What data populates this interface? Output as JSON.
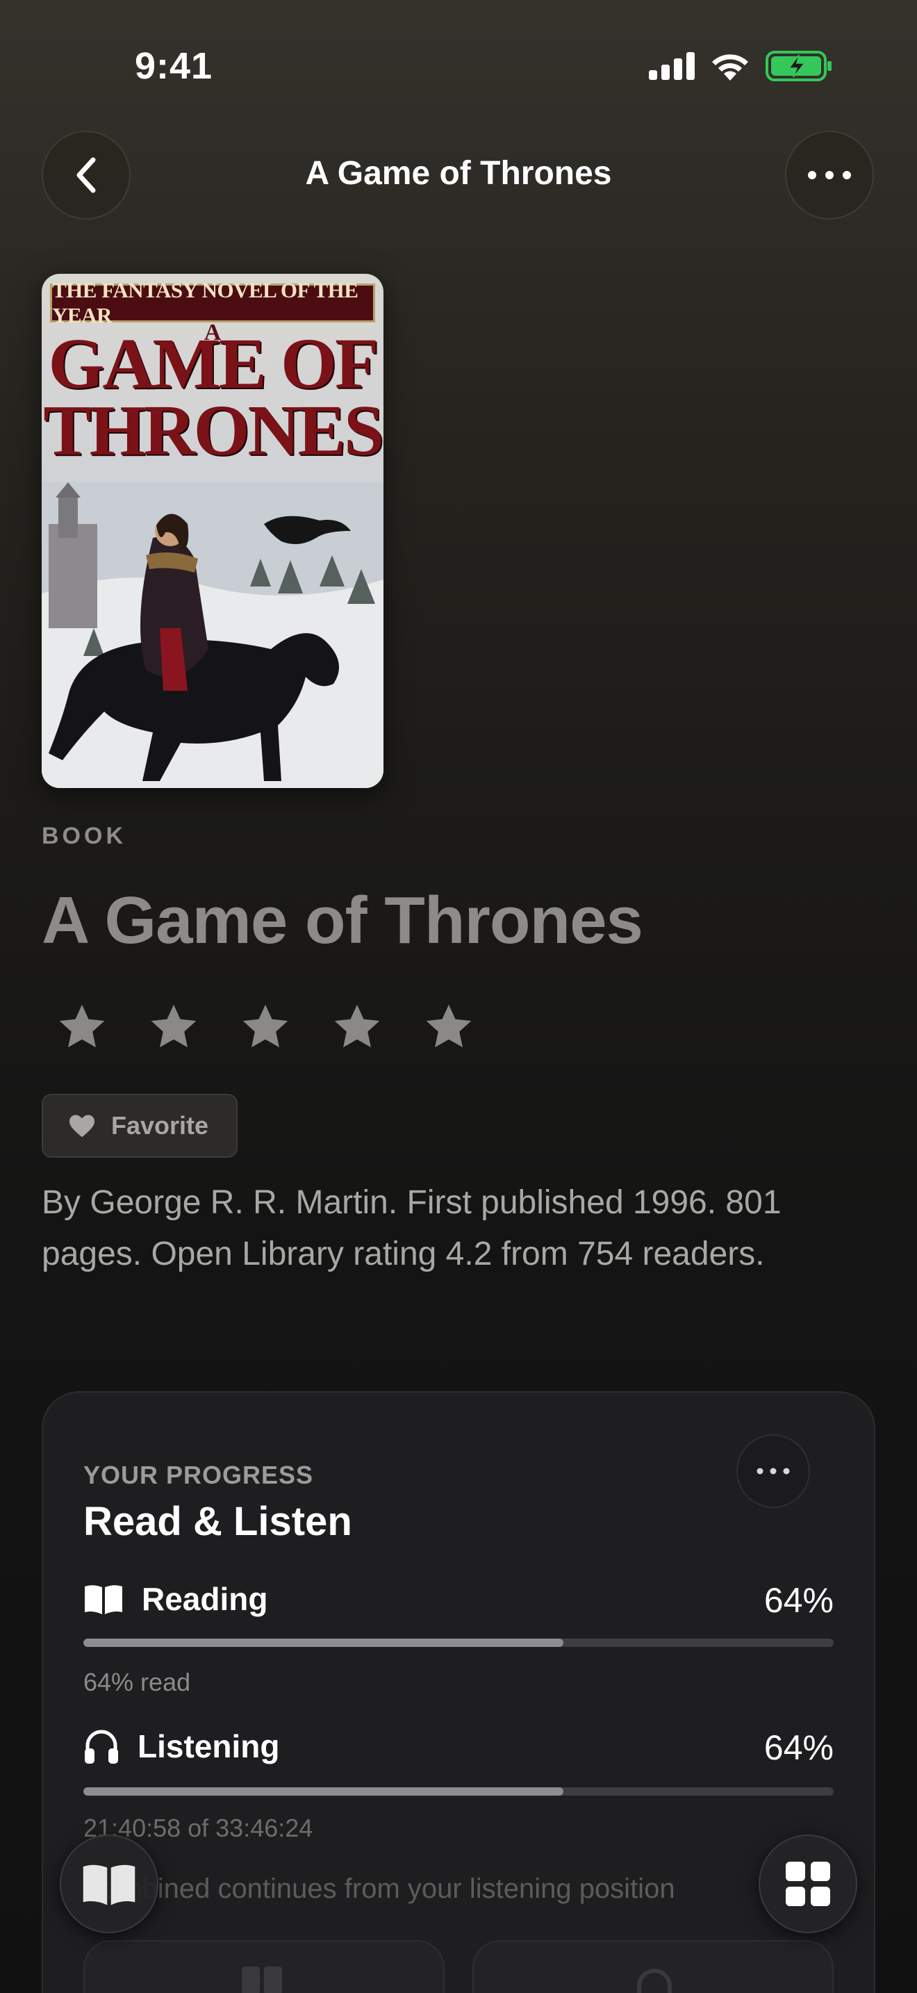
{
  "status_bar": {
    "time": "9:41"
  },
  "nav": {
    "title": "A Game of Thrones"
  },
  "cover": {
    "banner": "THE FANTASY NOVEL OF THE YEAR",
    "title_line1": "GAME OF",
    "title_line2": "THRONES",
    "small_a": "A"
  },
  "book": {
    "kind": "BOOK",
    "title": "A Game of Thrones",
    "rating_stars": 0,
    "favorite_label": "Favorite",
    "description": "By George R. R. Martin. First published 1996. 801 pages. Open Library rating 4.2 from 754 readers."
  },
  "progress": {
    "kicker": "YOUR PROGRESS",
    "title": "Read & Listen",
    "reading": {
      "label": "Reading",
      "percent_text": "64%",
      "fraction": 0.64,
      "sub": "64% read"
    },
    "listening": {
      "label": "Listening",
      "percent_text": "64%",
      "fraction": 0.64,
      "sub": "21:40:58 of 33:46:24"
    },
    "note": "Combined continues from your listening position"
  },
  "colors": {
    "accent_battery": "#34c759",
    "bar_fill": "#8e8e91",
    "bar_track": "#3e3e41"
  }
}
